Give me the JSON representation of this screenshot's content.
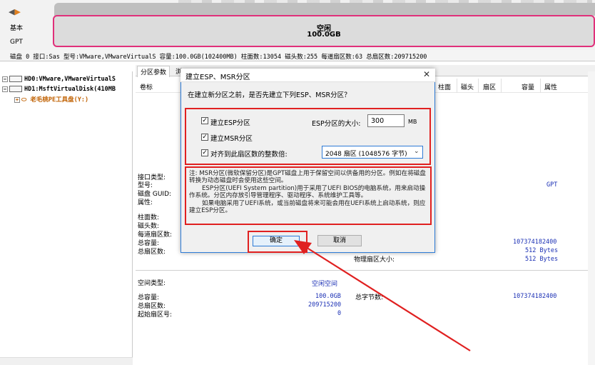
{
  "disk_map": {
    "nav": [
      "◀",
      "▶"
    ],
    "disk_kind": "基本",
    "partition_style": "GPT",
    "partition_title": "空闲",
    "partition_size": "100.0GB"
  },
  "disk_info_line": "磁盘 0 接口:Sas  型号:VMware,VMwareVirtualS  容量:100.0GB(102400MB)  柱面数:13054  磁头数:255  每道扇区数:63  总扇区数:209715200",
  "tree": {
    "items": [
      {
        "label": "HD0:VMware,VMwareVirtualS"
      },
      {
        "label": "HD1:MsftVirtualDisk(410MB"
      },
      {
        "label": "老毛桃PE工具盘(Y:)"
      }
    ]
  },
  "tabs": [
    "分区参数",
    "浏"
  ],
  "columns": [
    "卷标",
    "柱面",
    "磁头",
    "扇区",
    "容量",
    "属性"
  ],
  "disk_props": {
    "labels": [
      "接口类型:",
      "型号:",
      "磁盘 GUID:",
      "属性:"
    ],
    "gpt_value": "GPT",
    "geom_labels": [
      "柱面数:",
      "磁头数:",
      "每道扇区数:",
      "总容量:",
      "总扇区数:"
    ],
    "total_bytes": "107374182400",
    "sector_size_a": "512 Bytes",
    "sector_size_b": "512 Bytes",
    "physical_sector_label": "物理扇区大小:"
  },
  "space": {
    "type_label": "空间类型:",
    "type_value": "空闲空间",
    "total_label": "总容量:",
    "total_value": "100.0GB",
    "sectors_label": "总扇区数:",
    "sectors_value": "209715200",
    "start_label": "起始扇区号:",
    "start_value": "0",
    "total_bytes_label": "总字节数:",
    "total_bytes_value": "107374182400"
  },
  "dialog": {
    "title": "建立ESP、MSR分区",
    "close": "✕",
    "question": "在建立新分区之前，是否先建立下列ESP、MSR分区？",
    "esp_label": "建立ESP分区",
    "esp_size_label": "ESP分区的大小:",
    "esp_size_value": "300",
    "mb": "MB",
    "msr_label": "建立MSR分区",
    "align_label": "对齐到此扇区数的整数倍:",
    "align_value": "2048 扇区 (1048576 字节)",
    "check_mark": "✓",
    "notes": [
      "注: MSR分区(微软保留分区)是GPT磁盘上用于保留空间以供备用的分区。例如在将磁盘转换为动态磁盘时会使用这些空间。",
      "ESP分区(UEFI System partition)用于采用了UEFI BIOS的电脑系统，用来启动操作系统。分区内存放引导管理程序、驱动程序、系统维护工具等。",
      "如果电脑采用了UEFI系统，或当前磁盘将来可能会用在UEFI系统上启动系统，则应建立ESP分区。"
    ],
    "ok": "确定",
    "cancel": "取消"
  },
  "colors": {
    "highlight_red": "#e02020",
    "partition_border": "#e0307a",
    "accent_blue": "#2d7bd6",
    "value_blue": "#1a2fb4"
  }
}
